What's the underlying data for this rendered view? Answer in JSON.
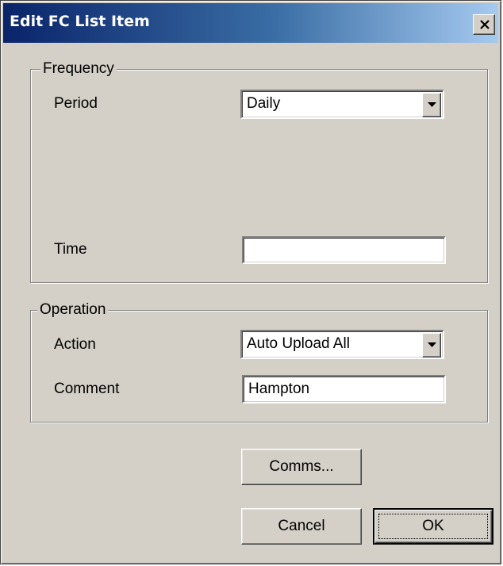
{
  "window": {
    "title": "Edit FC List Item",
    "close_icon": "close-icon"
  },
  "frequency": {
    "legend": "Frequency",
    "period_label": "Period",
    "period_value": "Daily",
    "time_label": "Time",
    "time_value": ""
  },
  "operation": {
    "legend": "Operation",
    "action_label": "Action",
    "action_value": "Auto Upload All",
    "comment_label": "Comment",
    "comment_value": "Hampton"
  },
  "buttons": {
    "comms": "Comms...",
    "cancel": "Cancel",
    "ok": "OK"
  },
  "colors": {
    "face": "#d4d0c8",
    "title_start": "#0a246a",
    "title_end": "#a6caf0"
  }
}
